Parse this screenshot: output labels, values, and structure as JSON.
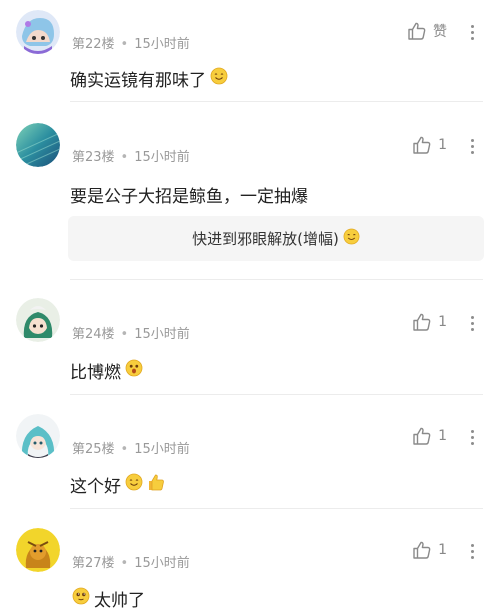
{
  "comments": [
    {
      "floor": "第22楼",
      "time": "15小时前",
      "like_label": "赞",
      "text": "确实运镜有那味了",
      "emoji": "smile-emoji"
    },
    {
      "floor": "第23楼",
      "time": "15小时前",
      "like_count": "1",
      "text": "要是公子大招是鲸鱼，一定抽爆",
      "reply": "快进到邪眼解放(增幅)",
      "reply_emoji": "smile-emoji"
    },
    {
      "floor": "第24楼",
      "time": "15小时前",
      "like_count": "1",
      "text": "比博燃",
      "emoji": "surprised-emoji"
    },
    {
      "floor": "第25楼",
      "time": "15小时前",
      "like_count": "1",
      "text": "这个好",
      "emoji": "smile-emoji",
      "emoji2": "thumbs-up-emoji"
    },
    {
      "floor": "第27楼",
      "time": "15小时前",
      "like_count": "1",
      "text": "太帅了",
      "emoji": "adoring-emoji"
    }
  ],
  "meta": {
    "separator": "•"
  },
  "colors": {
    "meta_text": "#999999",
    "body_text": "#222222",
    "reply_bg": "#f5f5f5"
  }
}
